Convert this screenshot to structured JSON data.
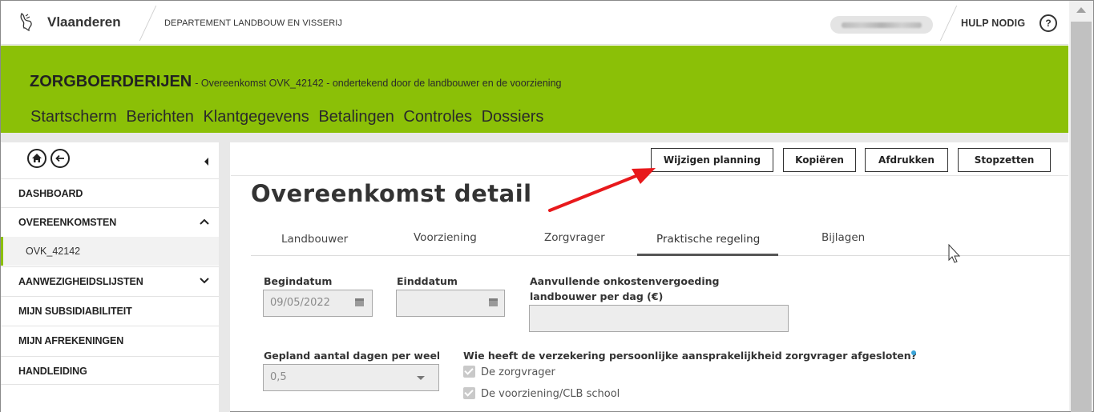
{
  "topbar": {
    "brand": "Vlaanderen",
    "department": "DEPARTEMENT LANDBOUW EN VISSERIJ",
    "help_label": "HULP NODIG",
    "help_icon_text": "?"
  },
  "header": {
    "app_name": "ZORGBOERDERIJEN",
    "subtitle": "- Overeenkomst OVK_42142 - ondertekend door de landbouwer en de voorziening",
    "nav": [
      "Startscherm",
      "Berichten",
      "Klantgegevens",
      "Betalingen",
      "Controles",
      "Dossiers"
    ],
    "color": "#8bc007"
  },
  "sidebar": {
    "home_icon": "home-icon",
    "back_icon": "arrow-left-icon",
    "items": [
      {
        "label": "DASHBOARD"
      },
      {
        "label": "OVEREENKOMSTEN",
        "chevron": "^"
      },
      {
        "label": "OVK_42142"
      },
      {
        "label": "AANWEZIGHEIDSLIJSTEN",
        "chevron": "v"
      },
      {
        "label": "MIJN SUBSIDIABILITEIT"
      },
      {
        "label": "MIJN AFREKENINGEN"
      },
      {
        "label": "HANDLEIDING"
      }
    ]
  },
  "toolbar": {
    "buttons": [
      "Wijzigen planning",
      "Kopiëren",
      "Afdrukken",
      "Stopzetten"
    ]
  },
  "page": {
    "title": "Overeenkomst detail",
    "tabs": [
      "Landbouwer",
      "Voorziening",
      "Zorgvrager",
      "Praktische regeling",
      "Bijlagen"
    ],
    "active_tab": "Praktische regeling"
  },
  "form": {
    "begindatum": {
      "label": "Begindatum",
      "value": "09/05/2022"
    },
    "einddatum": {
      "label": "Einddatum",
      "value": ""
    },
    "onkosten": {
      "label_line1": "Aanvullende onkostenvergoeding",
      "label_line2": "landbouwer per dag (€)",
      "value": ""
    },
    "dagen": {
      "label": "Gepland aantal dagen per week",
      "value": "0,5"
    },
    "verzekering": {
      "label": "Wie heeft de verzekering persoonlijke aansprakelijkheid zorgvrager afgesloten?",
      "options": [
        {
          "label": "De zorgvrager",
          "checked": true
        },
        {
          "label": "De voorziening/CLB school",
          "checked": true
        }
      ]
    }
  },
  "colors": {
    "accent": "#8bc007",
    "annotation_arrow": "#e8191c",
    "info": "#3aa4d8"
  }
}
